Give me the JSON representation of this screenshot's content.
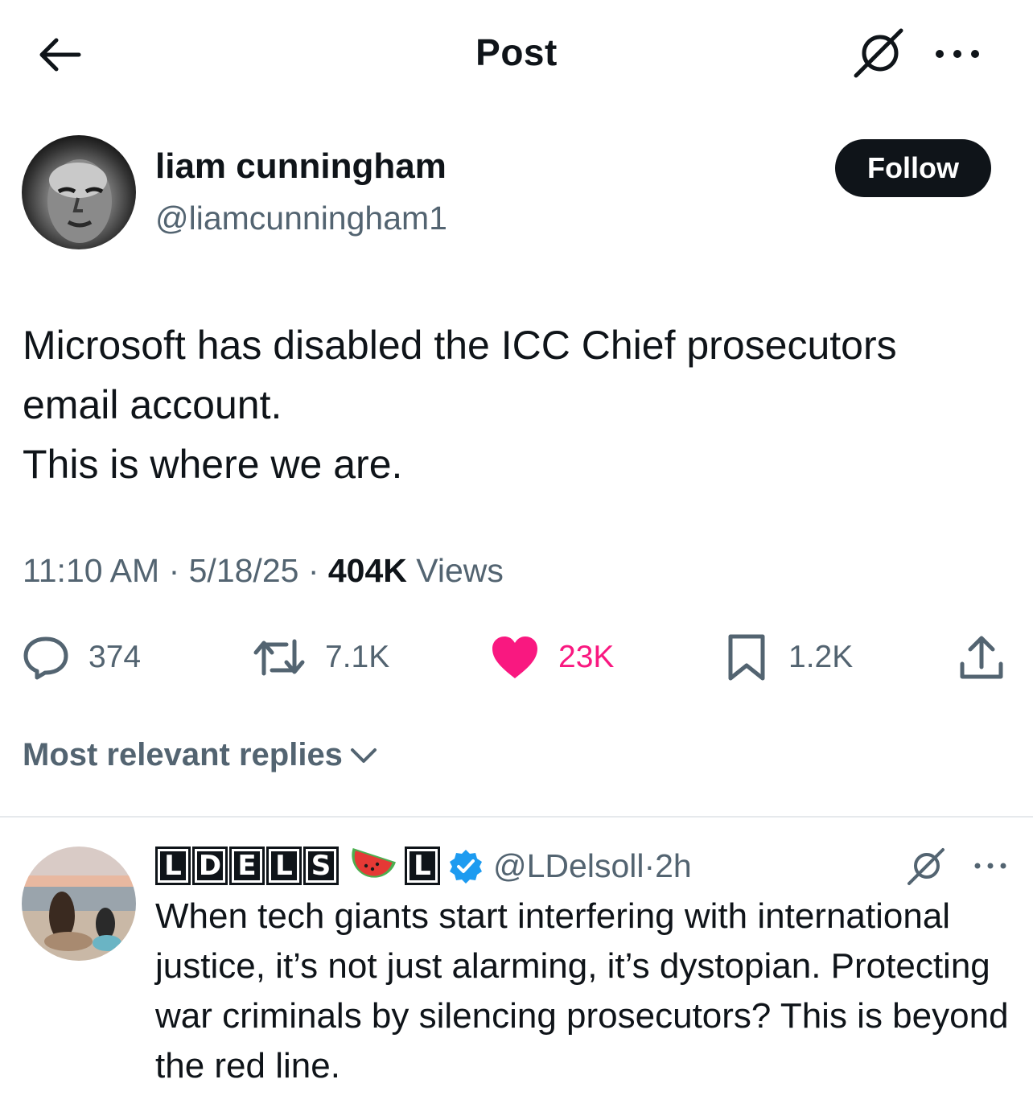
{
  "header": {
    "title": "Post"
  },
  "author": {
    "name": "liam cunningham",
    "handle": "@liamcunningham1",
    "follow_label": "Follow"
  },
  "tweet": {
    "lines": [
      "Microsoft has disabled the ICC Chief prosecutors",
      "email account.",
      "This is where we are."
    ]
  },
  "meta": {
    "time": "11:10 AM",
    "sep1": " · ",
    "date": "5/18/25",
    "sep2": " · ",
    "views_count": "404K",
    "views_label": " Views"
  },
  "actions": {
    "replies": "374",
    "reposts": "7.1K",
    "likes": "23K",
    "bookmarks": "1.2K"
  },
  "sort": {
    "label": "Most relevant replies"
  },
  "reply": {
    "name_letters": [
      "L",
      "D",
      "E",
      "L",
      "S"
    ],
    "name_tail_letter": "L",
    "handle": "@LDelsoll",
    "sep": " · ",
    "time": "2h",
    "text": "When tech giants start interfering with international justice, it’s not just alarming, it’s dystopian. Protecting war criminals by silencing prosecutors? This is beyond the red line."
  },
  "colors": {
    "like": "#f91880",
    "verified": "#1d9bf0",
    "secondary_text": "#536471",
    "primary_text": "#0f1419"
  },
  "icons": [
    "back-arrow-icon",
    "grok-icon",
    "more-icon",
    "reply-icon",
    "repost-icon",
    "like-icon",
    "bookmark-icon",
    "share-icon",
    "chevron-down-icon",
    "watermelon-icon",
    "verified-icon"
  ]
}
